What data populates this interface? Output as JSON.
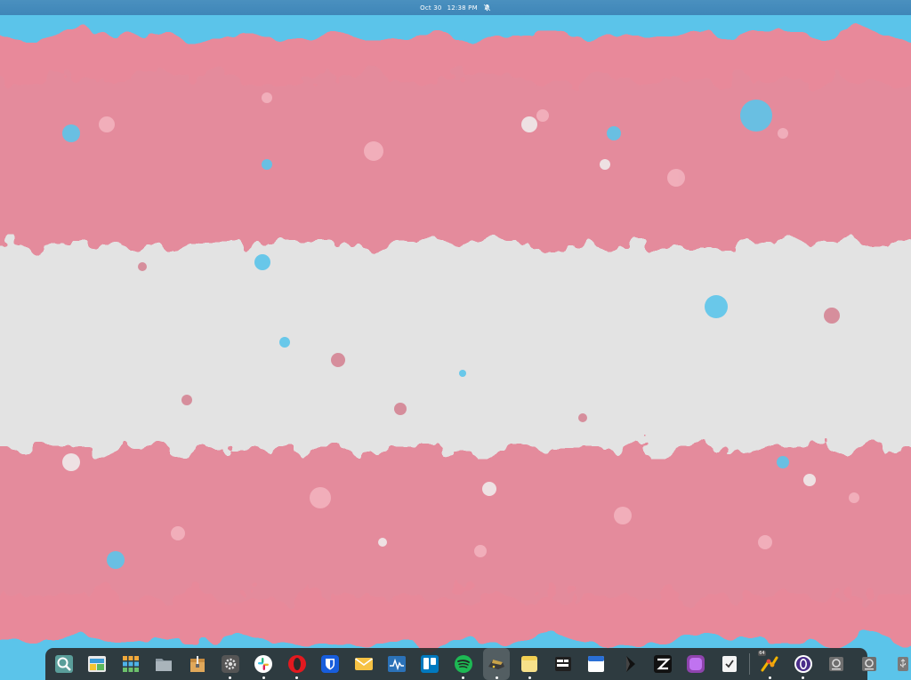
{
  "topbar": {
    "date": "Oct 30",
    "time": "12:38 PM",
    "notification_icon": "bell-off-icon"
  },
  "wallpaper": {
    "description_colors": {
      "blue": "#5bc4ea",
      "pink": "#e88a9b",
      "white": "#e6e6e6"
    }
  },
  "dock": {
    "items": [
      {
        "name": "search-app-icon",
        "running": false
      },
      {
        "name": "screenshot-app-icon",
        "running": false
      },
      {
        "name": "app-grid-icon",
        "running": false
      },
      {
        "name": "files-icon",
        "running": false
      },
      {
        "name": "archive-manager-icon",
        "running": false
      },
      {
        "name": "settings-icon",
        "running": true
      },
      {
        "name": "slack-icon",
        "running": true
      },
      {
        "name": "opera-icon",
        "running": true
      },
      {
        "name": "bitwarden-icon",
        "running": false
      },
      {
        "name": "mail-icon",
        "running": false
      },
      {
        "name": "system-monitor-icon",
        "running": false
      },
      {
        "name": "trello-icon",
        "running": false
      },
      {
        "name": "spotify-icon",
        "running": true
      },
      {
        "name": "terminal-icon",
        "running": true,
        "active": true
      },
      {
        "name": "notes-icon",
        "running": true
      },
      {
        "name": "tasks-icon",
        "running": false
      },
      {
        "name": "calendar-icon",
        "running": false
      },
      {
        "name": "inkscape-icon",
        "running": false
      },
      {
        "name": "zed-icon",
        "running": false
      },
      {
        "name": "purple-app-icon",
        "running": false
      },
      {
        "name": "todo-check-icon",
        "running": false
      },
      {
        "name": "git-app-icon",
        "running": true,
        "badge": "64"
      },
      {
        "name": "proton-icon",
        "running": true
      },
      {
        "name": "disk-icon",
        "running": false
      },
      {
        "name": "disk-icon-2",
        "running": false
      },
      {
        "name": "usb-drive-icon",
        "running": false
      },
      {
        "name": "eject-icon",
        "running": false
      }
    ]
  }
}
